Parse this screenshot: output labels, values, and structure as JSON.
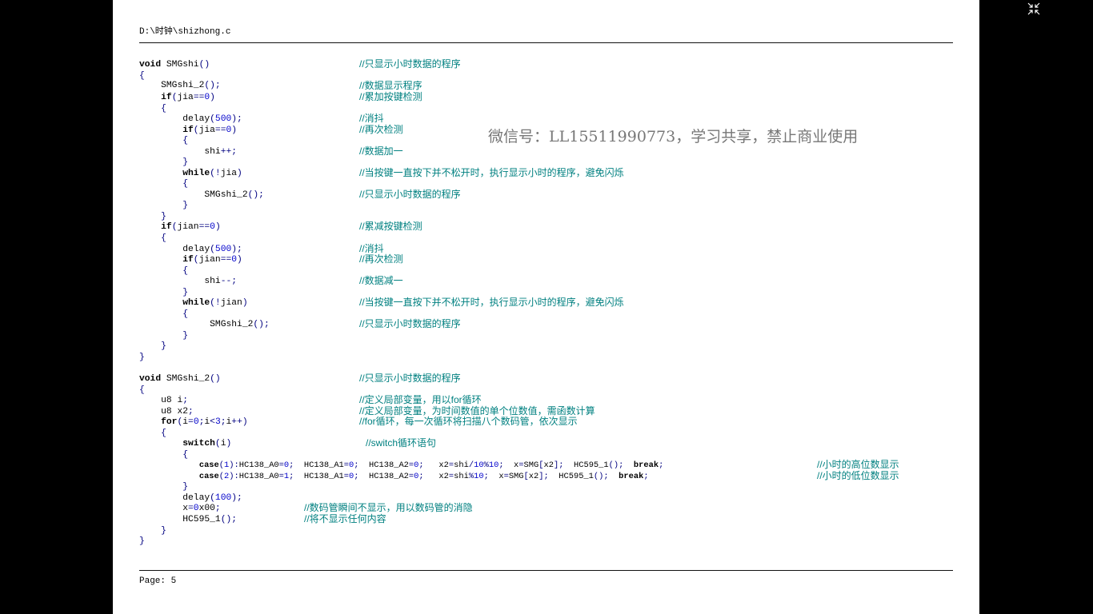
{
  "viewer": {
    "exit_fullscreen_icon": "exit-fullscreen-icon"
  },
  "document": {
    "path": "D:\\时钟\\shizhong.c",
    "footer": "Page: 5",
    "watermark": "微信号：LL15511990773，学习共享，禁止商业使用"
  },
  "code": [
    "void SMGshi()",
    "{",
    "    SMGshi_2();",
    "    if(jia==0)",
    "    {",
    "        delay(500);",
    "        if(jia==0)",
    "        {",
    "            shi++;",
    "        }",
    "        while(!jia)",
    "        {",
    "            SMGshi_2();",
    "        }",
    "    }",
    "    if(jian==0)",
    "    {",
    "        delay(500);",
    "        if(jian==0)",
    "        {",
    "            shi--;",
    "        }",
    "        while(!jian)",
    "        {",
    "             SMGshi_2();",
    "        }",
    "    }",
    "}",
    "void SMGshi_2()",
    "{",
    "    u8 i;",
    "    u8 x2;",
    "    for(i=0;i<3;i++)",
    "    {",
    "        switch(i)",
    "        {",
    "            case(1):HC138_A0=0;  HC138_A1=0;  HC138_A2=0;   x2=shi/10%10;  x=SMG[x2];  HC595_1();  break;",
    "            case(2):HC138_A0=1;  HC138_A1=0;  HC138_A2=0;   x2=shi%10;  x=SMG[x2];  HC595_1();  break;",
    "        }",
    "        delay(100);",
    "        x=0x00;",
    "        HC595_1();",
    "    }",
    "}"
  ],
  "comments": [
    "//只显示小时数据的程序",
    "//数据显示程序",
    "//累加按键检测",
    "//消抖",
    "//再次检测",
    "//数据加一",
    "//当按键一直按下并不松开时，执行显示小时的程序，避免闪烁",
    "//只显示小时数据的程序",
    "//累减按键检测",
    "//消抖",
    "//再次检测",
    "//数据减一",
    "//当按键一直按下并不松开时，执行显示小时的程序，避免闪烁",
    "//只显示小时数据的程序",
    "//只显示小时数据的程序",
    "//定义局部变量，用以for循环",
    "//定义局部变量，为时间数值的单个位数值，需函数计算",
    "//for循环，每一次循环将扫描八个数码管，依次显示",
    "//switch循环语句",
    "//小时的高位数显示",
    "//小时的低位数显示",
    "//数码管瞬间不显示，用以数码管的消隐",
    "//将不显示任何内容"
  ]
}
